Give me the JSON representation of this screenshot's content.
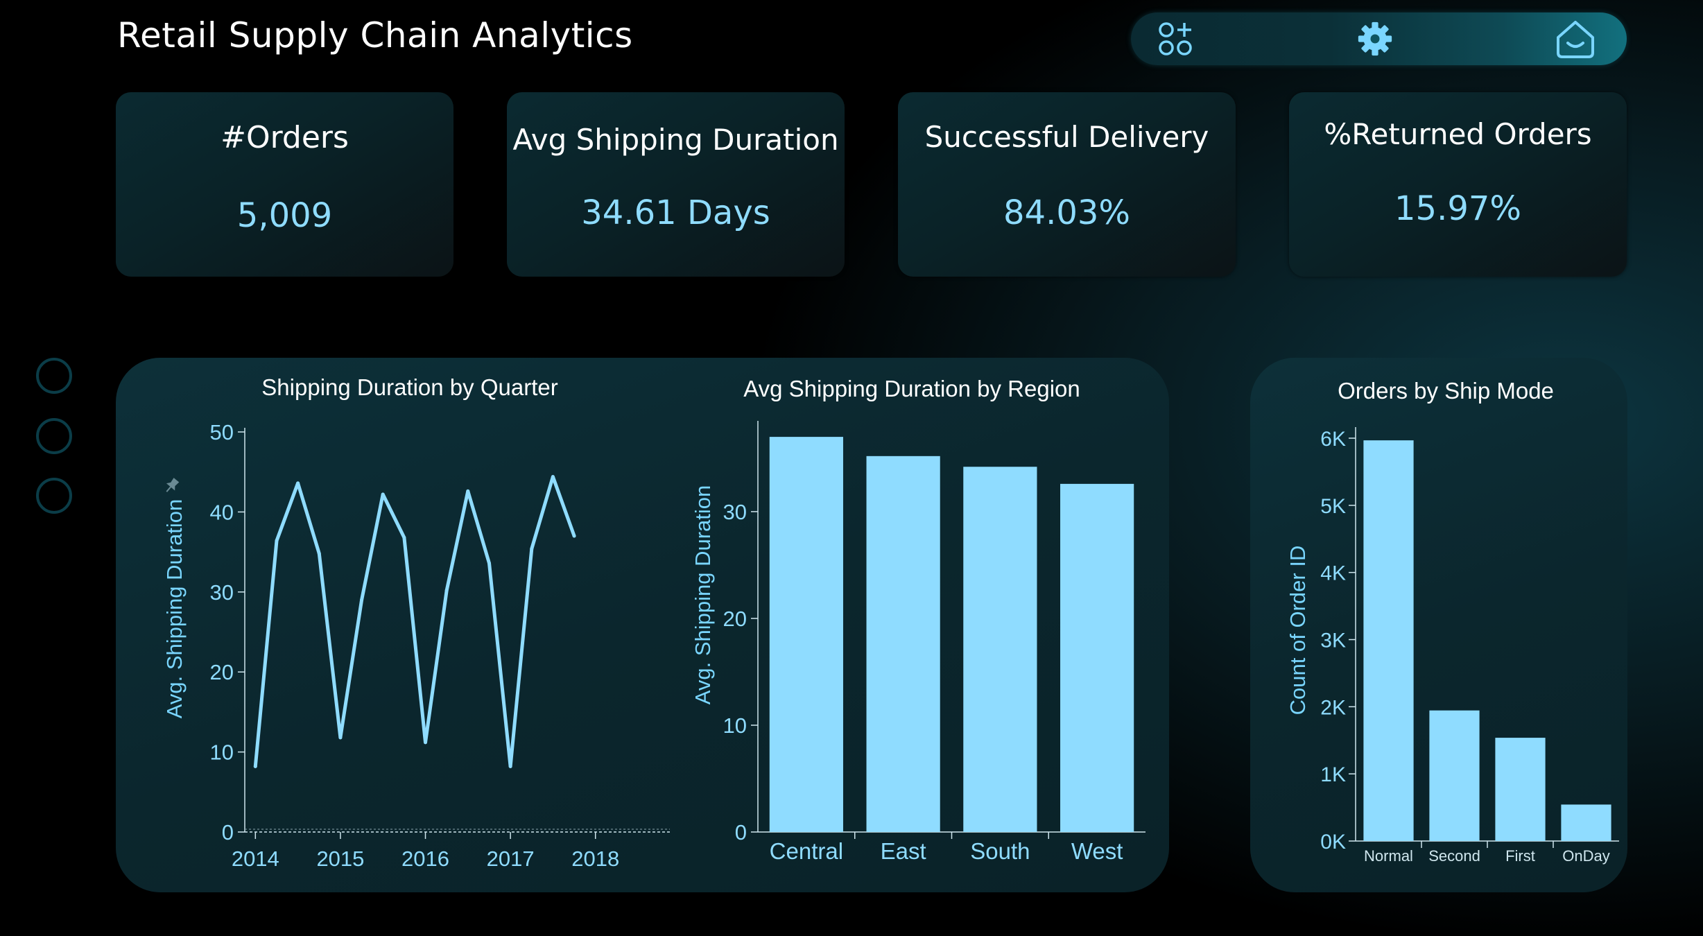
{
  "app": {
    "title": "Retail Supply Chain Analytics"
  },
  "toolbar": {
    "icons": [
      "apps-add-icon",
      "gear-icon",
      "home-icon"
    ]
  },
  "kpis": [
    {
      "label": "#Orders",
      "value": "5,009"
    },
    {
      "label": "Avg Shipping Duration",
      "value": "34.61 Days"
    },
    {
      "label": "Successful Delivery",
      "value": "84.03%"
    },
    {
      "label": "%Returned Orders",
      "value": "15.97%"
    }
  ],
  "colors": {
    "accent": "#8fdcff",
    "panel": "#0c2b33",
    "text": "#ffffff"
  },
  "chart_data": [
    {
      "type": "line",
      "title": "Shipping Duration by Quarter",
      "ylabel": "Avg. Shipping Duration",
      "xlabel": "",
      "x_ticks": [
        "2014",
        "2015",
        "2016",
        "2017",
        "2018"
      ],
      "y_ticks": [
        "0",
        "10",
        "20",
        "30",
        "40",
        "50"
      ],
      "ylim": [
        0,
        50
      ],
      "xlim": [
        2013.875,
        2018.875
      ],
      "series": [
        {
          "x": [
            2014.0,
            2014.25,
            2014.5,
            2014.75,
            2015.0,
            2015.25,
            2015.5,
            2015.75,
            2016.0,
            2016.25,
            2016.5,
            2016.75,
            2017.0,
            2017.25,
            2017.5,
            2017.75
          ],
          "values": [
            8.2,
            36.4,
            43.6,
            34.8,
            11.8,
            29.0,
            42.2,
            36.8,
            11.2,
            30.2,
            42.6,
            33.6,
            8.2,
            35.4,
            44.4,
            37.0
          ]
        }
      ]
    },
    {
      "type": "bar",
      "title": "Avg Shipping Duration by Region",
      "ylabel": "Avg. Shipping Duration",
      "xlabel": "",
      "categories": [
        "Central",
        "East",
        "South",
        "West"
      ],
      "values": [
        37.0,
        35.2,
        34.2,
        32.6
      ],
      "y_ticks": [
        "0",
        "10",
        "20",
        "30"
      ],
      "ylim": [
        0,
        38.5
      ]
    },
    {
      "type": "bar",
      "title": "Orders by Ship Mode",
      "ylabel": "Count of Order ID",
      "xlabel": "",
      "categories": [
        "Normal",
        "Second",
        "First",
        "OnDay"
      ],
      "values": [
        5968,
        1945,
        1538,
        543
      ],
      "y_ticks": [
        "0K",
        "1K",
        "2K",
        "3K",
        "4K",
        "5K",
        "6K"
      ],
      "ylim": [
        0,
        6000
      ]
    }
  ]
}
